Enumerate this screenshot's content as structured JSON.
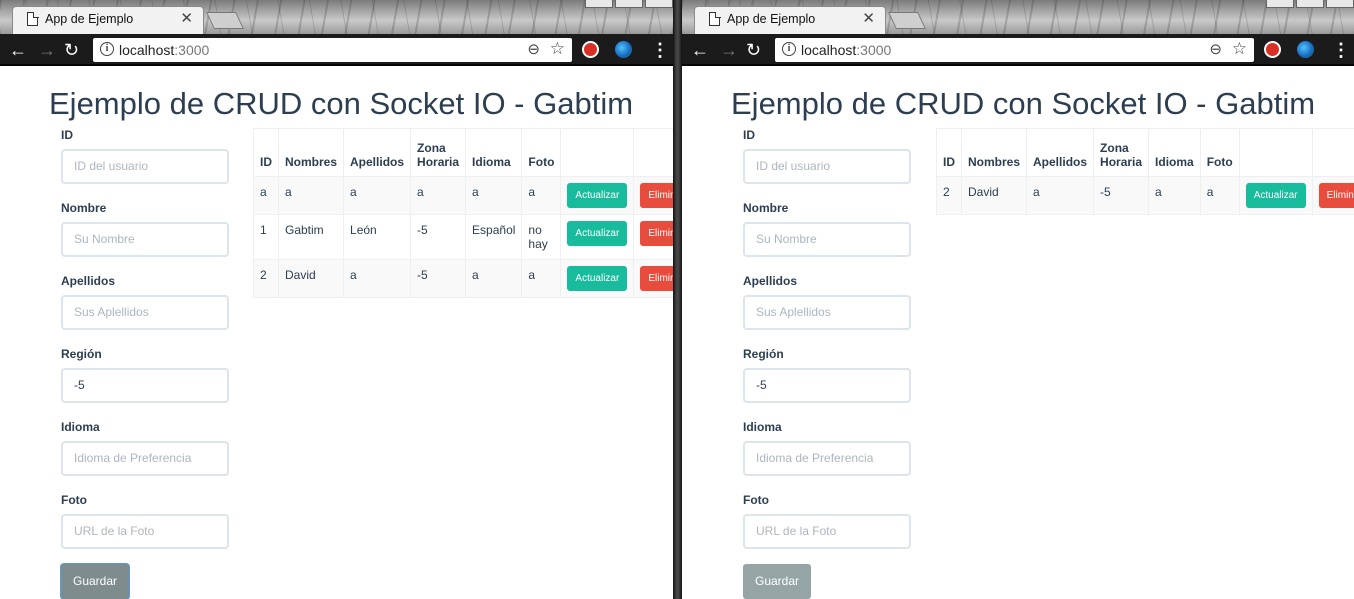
{
  "browser": {
    "tab_title": "App de Ejemplo",
    "url_host": "localhost",
    "url_port": ":3000"
  },
  "page": {
    "heading": "Ejemplo de CRUD con Socket IO - Gabtim"
  },
  "form": {
    "id_label": "ID",
    "id_placeholder": "ID del usuario",
    "nombre_label": "Nombre",
    "nombre_placeholder": "Su Nombre",
    "apellidos_label": "Apellidos",
    "apellidos_placeholder": "Sus Aplellidos",
    "region_label": "Región",
    "region_value": "-5",
    "idioma_label": "Idioma",
    "idioma_placeholder": "Idioma de Preferencia",
    "foto_label": "Foto",
    "foto_placeholder": "URL de la Foto",
    "save_label": "Guardar"
  },
  "table": {
    "headers": [
      "ID",
      "Nombres",
      "Apellidos",
      "Zona Horaria",
      "Idioma",
      "Foto"
    ],
    "update_label": "Actualizar",
    "delete_label_left": "Elimin",
    "delete_label_right": "Elimina"
  },
  "left_window": {
    "rows": [
      {
        "id": "a",
        "nombres": "a",
        "apellidos": "a",
        "zona": "a",
        "idioma": "a",
        "foto": "a"
      },
      {
        "id": "1",
        "nombres": "Gabtim",
        "apellidos": "León",
        "zona": "-5",
        "idioma": "Español",
        "foto": "no hay"
      },
      {
        "id": "2",
        "nombres": "David",
        "apellidos": "a",
        "zona": "-5",
        "idioma": "a",
        "foto": "a"
      }
    ]
  },
  "right_window": {
    "rows": [
      {
        "id": "2",
        "nombres": "David",
        "apellidos": "a",
        "zona": "-5",
        "idioma": "a",
        "foto": "a"
      }
    ]
  },
  "colors": {
    "heading": "#2c3e50",
    "update_button": "#18bc9c",
    "delete_button": "#e74c3c",
    "save_button": "#95a5a6"
  }
}
